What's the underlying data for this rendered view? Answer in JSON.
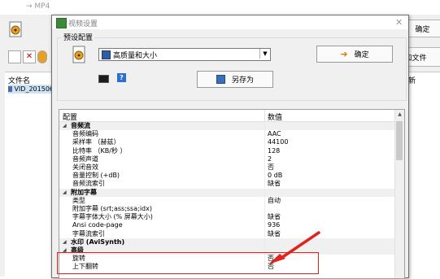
{
  "background_window": {
    "title": "→ MP4",
    "ok_label": "确定",
    "add_file_label": "添加文件",
    "col_filename": "文件名",
    "col_right": "新",
    "file_row": "VID_201506"
  },
  "dialog": {
    "title": "视频设置",
    "preset_label": "预设配置",
    "preset_value": "高质量和大小",
    "ok_label": "确定",
    "save_as_label": "另存为",
    "help_label": "?",
    "grid": {
      "header_name": "配置",
      "header_value": "数值",
      "rows": [
        {
          "type": "cat",
          "name": "音频流",
          "value": ""
        },
        {
          "type": "item",
          "name": "音频编码",
          "value": "AAC"
        },
        {
          "type": "item",
          "name": "采样率 （赫兹）",
          "value": "44100"
        },
        {
          "type": "item",
          "name": "比特率 （KB/秒 ）",
          "value": "128"
        },
        {
          "type": "item",
          "name": "音频声道",
          "value": "2"
        },
        {
          "type": "item",
          "name": "关闭音效",
          "value": "否"
        },
        {
          "type": "item",
          "name": "音量控制 (+dB)",
          "value": "0 dB"
        },
        {
          "type": "item",
          "name": "音频流索引",
          "value": "缺省"
        },
        {
          "type": "cat",
          "name": "附加字幕",
          "value": ""
        },
        {
          "type": "item",
          "name": "类型",
          "value": "自动"
        },
        {
          "type": "item",
          "name": "附加字幕 (srt;ass;ssa;idx)",
          "value": ""
        },
        {
          "type": "item",
          "name": "字幕字体大小 (% 屏幕大小)",
          "value": "缺省"
        },
        {
          "type": "item",
          "name": "Ansi code-page",
          "value": "936"
        },
        {
          "type": "item",
          "name": "字幕流索引",
          "value": "缺省"
        },
        {
          "type": "cat",
          "name": "水印 (AviSynth)",
          "value": ""
        },
        {
          "type": "cat",
          "name": "高级",
          "value": ""
        },
        {
          "type": "item",
          "name": "旋转",
          "value": "否"
        },
        {
          "type": "item",
          "name": "上下翻转",
          "value": "否"
        }
      ]
    }
  },
  "colors": {
    "annotation": "#e0241c",
    "selection": "#cfe3f7",
    "accent_ok_arrow": "#e07a10"
  },
  "icons": [
    "app-icon",
    "dialog-title-icon",
    "close-icon",
    "preset-icon",
    "preset-item-icon",
    "dropdown-arrow-icon",
    "ok-arrow-icon",
    "save-icon",
    "command-line-icon",
    "help-icon",
    "expand-icon",
    "scroll-up-icon",
    "annotation-arrow"
  ]
}
